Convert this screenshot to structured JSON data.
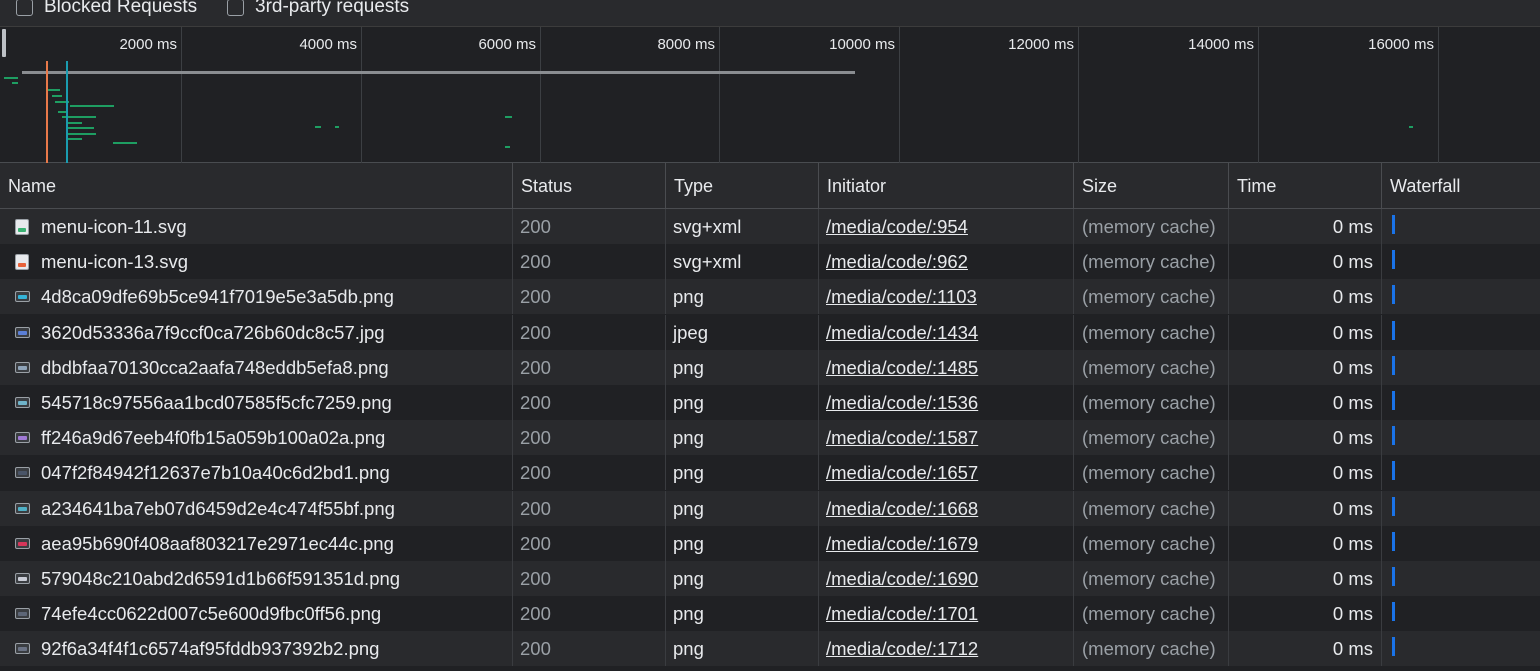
{
  "filters": {
    "blocked_requests": "Blocked Requests",
    "third_party": "3rd-party requests"
  },
  "overview": {
    "ticks": [
      "2000 ms",
      "4000 ms",
      "6000 ms",
      "8000 ms",
      "10000 ms",
      "12000 ms",
      "14000 ms",
      "16000 ms"
    ]
  },
  "columns": {
    "name": "Name",
    "status": "Status",
    "type": "Type",
    "initiator": "Initiator",
    "size": "Size",
    "time": "Time",
    "waterfall": "Waterfall"
  },
  "rows": [
    {
      "name": "menu-icon-11.svg",
      "status": "200",
      "type": "svg+xml",
      "initiator": "/media/code/:954",
      "size": "(memory cache)",
      "time": "0 ms",
      "icon": "svg-file-icon",
      "color": "#3bb273"
    },
    {
      "name": "menu-icon-13.svg",
      "status": "200",
      "type": "svg+xml",
      "initiator": "/media/code/:962",
      "size": "(memory cache)",
      "time": "0 ms",
      "icon": "svg-file-icon",
      "color": "#e8623a"
    },
    {
      "name": "4d8ca09dfe69b5ce941f7019e5e3a5db.png",
      "status": "200",
      "type": "png",
      "initiator": "/media/code/:1103",
      "size": "(memory cache)",
      "time": "0 ms",
      "icon": "image-file-icon",
      "color": "#34b4d9"
    },
    {
      "name": "3620d53336a7f9ccf0ca726b60dc8c57.jpg",
      "status": "200",
      "type": "jpeg",
      "initiator": "/media/code/:1434",
      "size": "(memory cache)",
      "time": "0 ms",
      "icon": "image-file-icon",
      "color": "#5b7fd6"
    },
    {
      "name": "dbdbfaa70130cca2aafa748eddb5efa8.png",
      "status": "200",
      "type": "png",
      "initiator": "/media/code/:1485",
      "size": "(memory cache)",
      "time": "0 ms",
      "icon": "image-file-icon",
      "color": "#8ea3b8"
    },
    {
      "name": "545718c97556aa1bcd07585f5cfc7259.png",
      "status": "200",
      "type": "png",
      "initiator": "/media/code/:1536",
      "size": "(memory cache)",
      "time": "0 ms",
      "icon": "image-file-icon",
      "color": "#6fb3c9"
    },
    {
      "name": "ff246a9d67eeb4f0fb15a059b100a02a.png",
      "status": "200",
      "type": "png",
      "initiator": "/media/code/:1587",
      "size": "(memory cache)",
      "time": "0 ms",
      "icon": "image-file-icon",
      "color": "#a07ad6"
    },
    {
      "name": "047f2f84942f12637e7b10a40c6d2bd1.png",
      "status": "200",
      "type": "png",
      "initiator": "/media/code/:1657",
      "size": "(memory cache)",
      "time": "0 ms",
      "icon": "image-file-icon",
      "color": "#4a5568"
    },
    {
      "name": "a234641ba7eb07d6459d2e4c474f55bf.png",
      "status": "200",
      "type": "png",
      "initiator": "/media/code/:1668",
      "size": "(memory cache)",
      "time": "0 ms",
      "icon": "image-file-icon",
      "color": "#4fb0c6"
    },
    {
      "name": "aea95b690f408aaf803217e2971ec44c.png",
      "status": "200",
      "type": "png",
      "initiator": "/media/code/:1679",
      "size": "(memory cache)",
      "time": "0 ms",
      "icon": "image-file-icon",
      "color": "#d6365a"
    },
    {
      "name": "579048c210abd2d6591d1b66f591351d.png",
      "status": "200",
      "type": "png",
      "initiator": "/media/code/:1690",
      "size": "(memory cache)",
      "time": "0 ms",
      "icon": "image-file-icon",
      "color": "#c9ccd6"
    },
    {
      "name": "74efe4cc0622d007c5e600d9fbc0ff56.png",
      "status": "200",
      "type": "png",
      "initiator": "/media/code/:1701",
      "size": "(memory cache)",
      "time": "0 ms",
      "icon": "image-file-icon",
      "color": "#5d6677"
    },
    {
      "name": "92f6a34f4f1c6574af95fddb937392b2.png",
      "status": "200",
      "type": "png",
      "initiator": "/media/code/:1712",
      "size": "(memory cache)",
      "time": "0 ms",
      "icon": "image-file-icon",
      "color": "#6b7385"
    }
  ],
  "colors": {
    "background": "#202124",
    "row_alt": "#292a2d",
    "waterfall_bar": "#1a73e8",
    "overview_green": "#1e9e62",
    "dom_content_loaded": "#1a9cb0",
    "load_event": "#e8794a"
  }
}
